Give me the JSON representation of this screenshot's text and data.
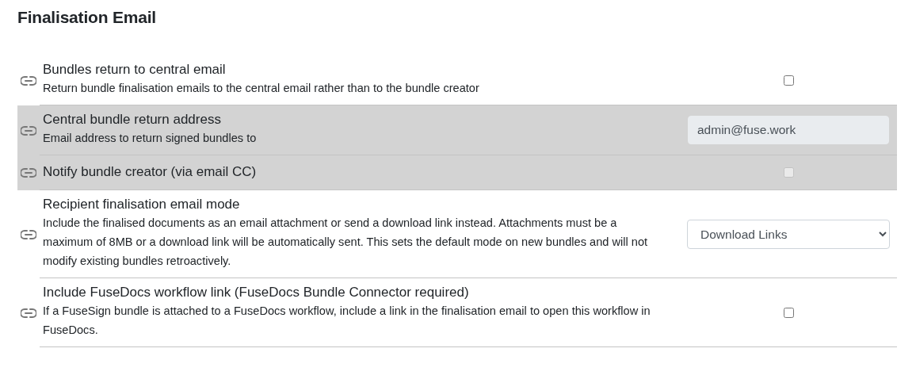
{
  "heading": "Finalisation Email",
  "settings": [
    {
      "title": "Bundles return to central email",
      "description": "Return bundle finalisation emails to the central email rather than to the bundle creator",
      "kind": "checkbox",
      "checked": false,
      "disabled": false
    },
    {
      "title": "Central bundle return address",
      "description": "Email address to return signed bundles to",
      "kind": "text",
      "value": "admin@fuse.work",
      "disabled": true
    },
    {
      "title": "Notify bundle creator (via email CC)",
      "kind": "checkbox",
      "checked": false,
      "disabled": true
    },
    {
      "title": "Recipient finalisation email mode",
      "description": "Include the finalised documents as an email attachment or send a download link instead. Attachments must be a maximum of 8MB or a download link will be automatically sent. This sets the default mode on new bundles and will not modify existing bundles retroactively.",
      "kind": "select",
      "value": "Download Links",
      "disabled": false
    },
    {
      "title": "Include FuseDocs workflow link (FuseDocs Bundle Connector required)",
      "description": "If a FuseSign bundle is attached to a FuseDocs workflow, include a link in the finalisation email to open this workflow in FuseDocs.",
      "kind": "checkbox",
      "checked": false,
      "disabled": false
    }
  ]
}
